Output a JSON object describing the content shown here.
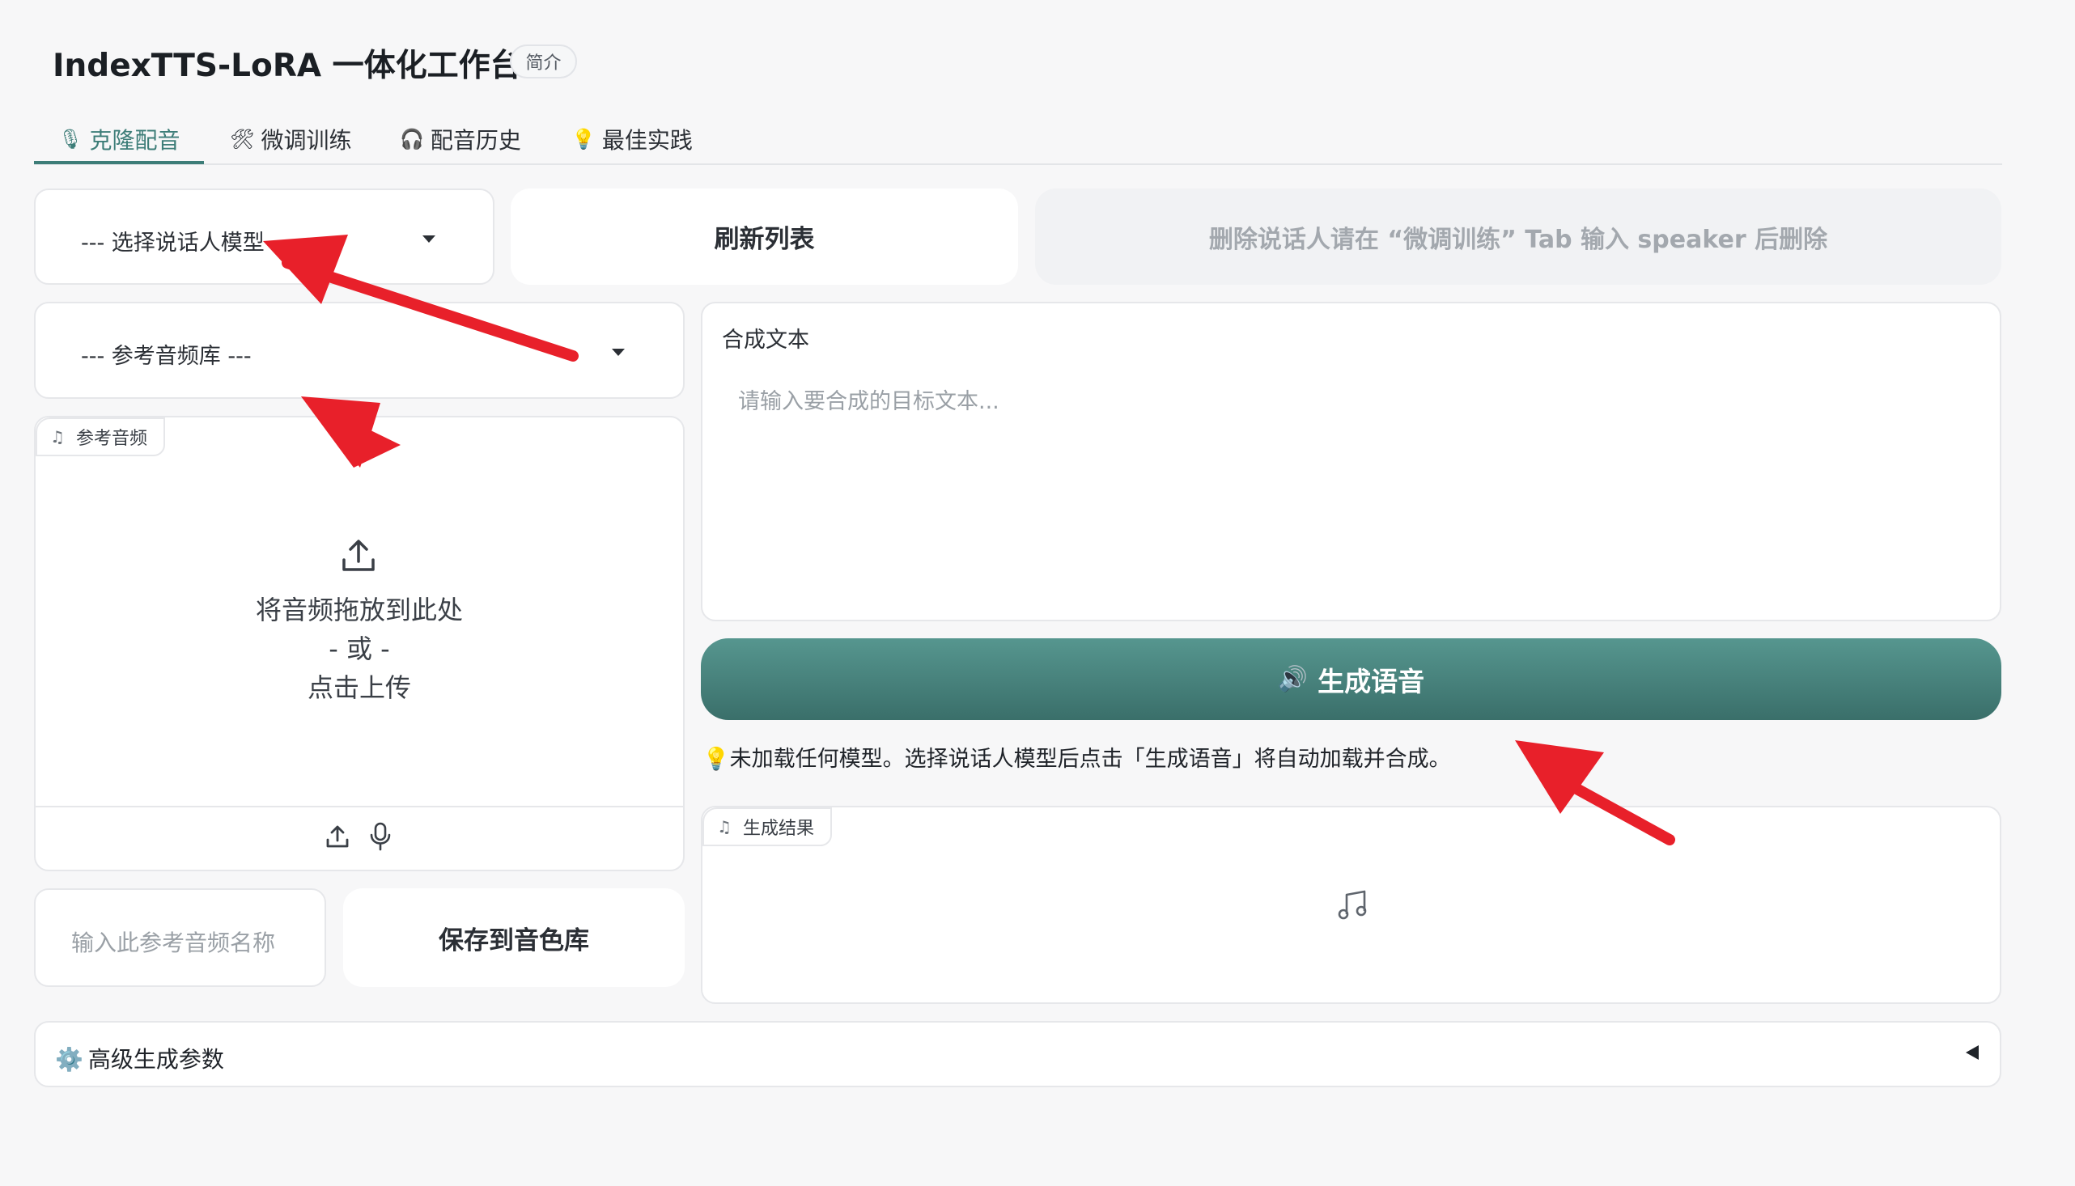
{
  "header": {
    "title": "IndexTTS-LoRA 一体化工作台",
    "intro_badge": "简介"
  },
  "tabs": [
    {
      "icon": "🎙",
      "label": "克隆配音",
      "active": true
    },
    {
      "icon": "🛠",
      "label": "微调训练",
      "active": false
    },
    {
      "icon": "🎧",
      "label": "配音历史",
      "active": false
    },
    {
      "icon": "💡",
      "label": "最佳实践",
      "active": false
    }
  ],
  "speaker_select": {
    "value": "--- 选择说话人模型 ---"
  },
  "refresh_button": "刷新列表",
  "delete_hint_button": "删除说话人请在 “微调训练” Tab 输入 speaker 后删除",
  "reference_library_select": {
    "value": "--- 参考音频库 ---"
  },
  "reference_audio": {
    "label": "参考音频",
    "drop_text": "将音频拖放到此处",
    "or_text": "- 或 -",
    "click_text": "点击上传"
  },
  "reference_name_input": {
    "placeholder": "输入此参考音频名称",
    "value": ""
  },
  "save_button": "保存到音色库",
  "synthesis_text": {
    "label": "合成文本",
    "placeholder": "请输入要合成的目标文本..."
  },
  "generate_button": {
    "icon": "🔊",
    "label": "生成语音"
  },
  "status": {
    "icon": "💡",
    "text": "未加载任何模型。选择说话人模型后点击「生成语音」将自动加载并合成。"
  },
  "result_audio": {
    "label": "生成结果"
  },
  "advanced": {
    "icon": "⚙️",
    "label": "高级生成参数"
  },
  "colors": {
    "accent": "#3d7d78",
    "button_gradient_top": "#56968f",
    "button_gradient_bottom": "#3a6f6a",
    "annotation_arrow": "#e8202a"
  }
}
